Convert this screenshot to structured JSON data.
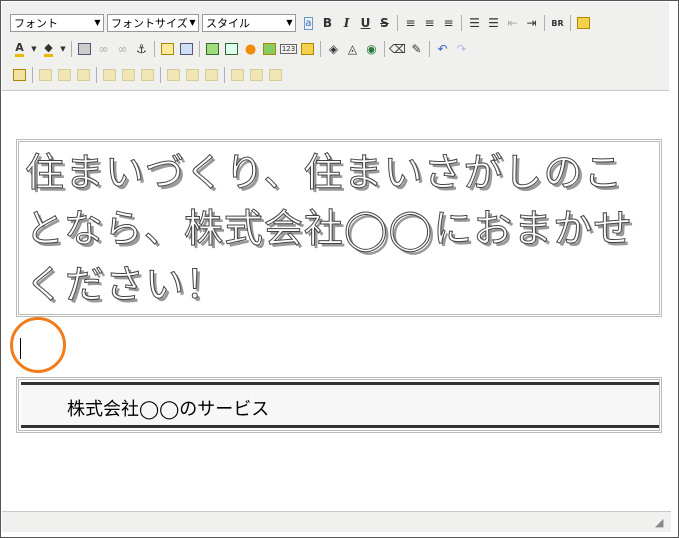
{
  "toolbar": {
    "font_select": "フォント",
    "size_select": "フォントサイズ",
    "style_select": "スタイル",
    "bold": "B",
    "italic": "I",
    "underline": "U",
    "strike": "S",
    "br": "BR"
  },
  "content": {
    "heading": "住まいづくり、住まいさがしのことなら、株式会社◯◯におまかせください！",
    "service_title": "株式会社◯◯のサービス"
  },
  "colors": {
    "highlight_circle": "#f07c1b",
    "toolbar_bg": "#f0f0ee"
  }
}
